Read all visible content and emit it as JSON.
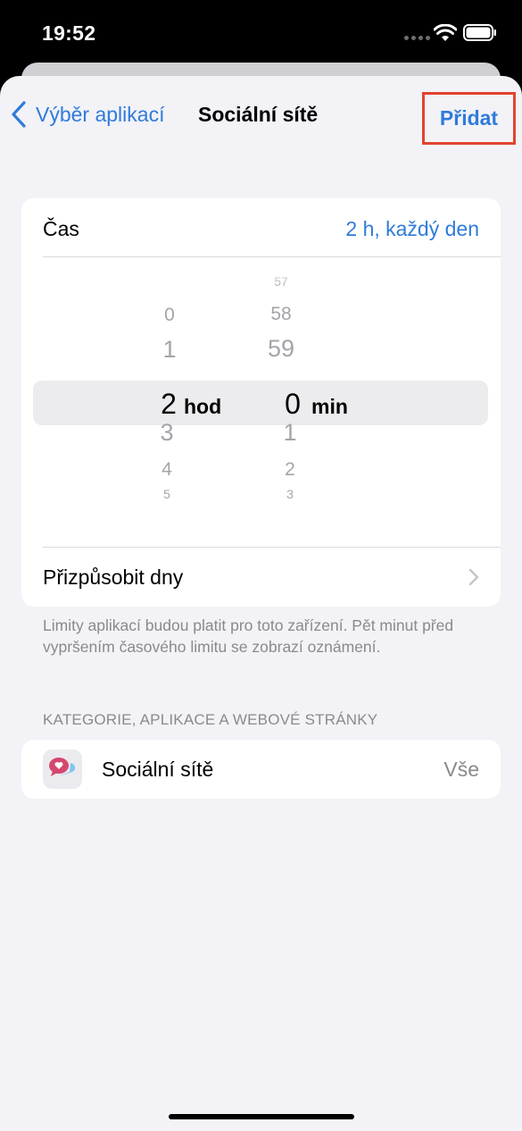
{
  "status": {
    "time": "19:52"
  },
  "nav": {
    "back_label": "Výběr aplikací",
    "title": "Sociální sítě",
    "add_label": "Přidat"
  },
  "time_row": {
    "label": "Čas",
    "value": "2 h, každý den"
  },
  "picker": {
    "hours_above": [
      "0",
      "1"
    ],
    "hours_selected": "2",
    "hours_unit": "hod",
    "hours_below": [
      "3",
      "4",
      "5"
    ],
    "minutes_above": [
      "57",
      "58",
      "59"
    ],
    "minutes_selected": "0",
    "minutes_unit": "min",
    "minutes_below": [
      "1",
      "2",
      "3"
    ]
  },
  "customize_days": {
    "label": "Přizpůsobit dny"
  },
  "footnote": "Limity aplikací budou platit pro toto zařízení. Pět minut před vypršením časového limitu se zobrazí oznámení.",
  "section_header": "KATEGORIE, APLIKACE A WEBOVÉ STRÁNKY",
  "category": {
    "name": "Sociální sítě",
    "value": "Vše",
    "icon": "social-networks-icon"
  },
  "colors": {
    "accent": "#2f7bd9",
    "highlight_box": "#e2432f",
    "background": "#f2f2f7"
  }
}
